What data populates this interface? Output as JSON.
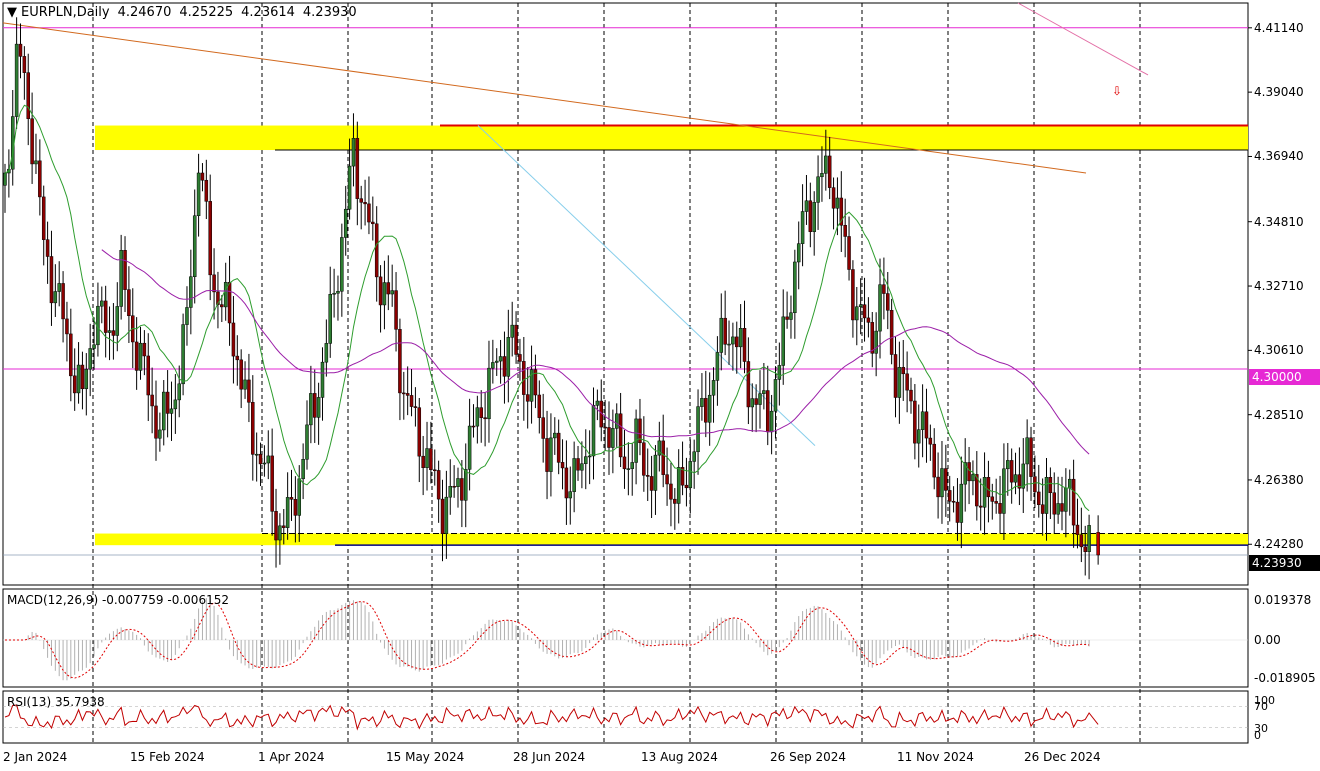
{
  "chart_title": {
    "symbol_timeframe": "EURPLN,Daily",
    "ohlc": [
      "4.24670",
      "4.25225",
      "4.23614",
      "4.23930"
    ]
  },
  "chart_data": [
    {
      "type": "candlestick",
      "name": "EURPLN,Daily",
      "open": 4.2467,
      "high": 4.25225,
      "low": 4.23614,
      "close": 4.2393,
      "y_ticks": [
        "4.41140",
        "4.39040",
        "4.36940",
        "4.34810",
        "4.32710",
        "4.30610",
        "4.28510",
        "4.26380",
        "4.24280"
      ],
      "ylim": [
        4.2295,
        4.4195
      ],
      "x_ticks": [
        "2 Jan 2024",
        "15 Feb 2024",
        "1 Apr 2024",
        "15 May 2024",
        "28 Jun 2024",
        "13 Aug 2024",
        "26 Sep 2024",
        "11 Nov 2024",
        "26 Dec 2024"
      ],
      "horizontal_levels": [
        {
          "value": 4.3,
          "label": "4.30000",
          "color": "#e629d4"
        },
        {
          "value": 4.4114,
          "color": "#e629d4"
        }
      ],
      "last_price_label": "4.23930",
      "zones": [
        {
          "from": 4.3715,
          "to": 4.3795,
          "color": "#ffff00"
        },
        {
          "from": 4.2425,
          "to": 4.2463,
          "color": "#ffff00"
        }
      ],
      "moving_averages": [
        "green",
        "purple"
      ],
      "trendlines": [
        "orange descending",
        "light blue descending",
        "pink descending"
      ],
      "grid": "vertical dashed",
      "series_points": [
        [
          0,
          4.36
        ],
        [
          10,
          4.405
        ],
        [
          20,
          4.38
        ],
        [
          30,
          4.34
        ],
        [
          40,
          4.325
        ],
        [
          50,
          4.305
        ],
        [
          60,
          4.29
        ],
        [
          70,
          4.32
        ],
        [
          80,
          4.31
        ],
        [
          90,
          4.33
        ],
        [
          100,
          4.31
        ],
        [
          110,
          4.295
        ],
        [
          120,
          4.28
        ],
        [
          130,
          4.29
        ],
        [
          140,
          4.31
        ],
        [
          150,
          4.37
        ],
        [
          160,
          4.33
        ],
        [
          170,
          4.32
        ],
        [
          180,
          4.305
        ],
        [
          190,
          4.28
        ],
        [
          200,
          4.27
        ],
        [
          210,
          4.25
        ],
        [
          220,
          4.25
        ],
        [
          230,
          4.27
        ],
        [
          240,
          4.29
        ],
        [
          250,
          4.31
        ],
        [
          260,
          4.34
        ],
        [
          270,
          4.37
        ],
        [
          280,
          4.35
        ],
        [
          290,
          4.33
        ],
        [
          300,
          4.32
        ],
        [
          310,
          4.29
        ],
        [
          320,
          4.28
        ],
        [
          330,
          4.265
        ],
        [
          340,
          4.255
        ],
        [
          350,
          4.26
        ],
        [
          360,
          4.275
        ],
        [
          370,
          4.29
        ],
        [
          380,
          4.3
        ],
        [
          390,
          4.31
        ],
        [
          400,
          4.3
        ],
        [
          410,
          4.29
        ],
        [
          420,
          4.275
        ],
        [
          430,
          4.27
        ],
        [
          440,
          4.26
        ],
        [
          450,
          4.275
        ],
        [
          460,
          4.285
        ],
        [
          470,
          4.28
        ],
        [
          480,
          4.27
        ],
        [
          490,
          4.275
        ],
        [
          500,
          4.265
        ],
        [
          510,
          4.27
        ],
        [
          520,
          4.255
        ],
        [
          530,
          4.27
        ],
        [
          540,
          4.285
        ],
        [
          550,
          4.3
        ],
        [
          560,
          4.315
        ],
        [
          570,
          4.305
        ],
        [
          580,
          4.29
        ],
        [
          590,
          4.285
        ],
        [
          600,
          4.3
        ],
        [
          610,
          4.33
        ],
        [
          620,
          4.35
        ],
        [
          630,
          4.36
        ],
        [
          640,
          4.365
        ],
        [
          650,
          4.34
        ],
        [
          660,
          4.32
        ],
        [
          670,
          4.31
        ],
        [
          680,
          4.325
        ],
        [
          690,
          4.3
        ],
        [
          700,
          4.29
        ],
        [
          710,
          4.28
        ],
        [
          720,
          4.27
        ],
        [
          730,
          4.255
        ],
        [
          740,
          4.26
        ],
        [
          750,
          4.265
        ],
        [
          760,
          4.255
        ],
        [
          770,
          4.26
        ],
        [
          780,
          4.265
        ],
        [
          790,
          4.27
        ],
        [
          800,
          4.26
        ],
        [
          810,
          4.255
        ],
        [
          820,
          4.26
        ],
        [
          830,
          4.25
        ],
        [
          840,
          4.2393
        ]
      ]
    },
    {
      "type": "bar",
      "name": "MACD(12,26,9)",
      "values_label": [
        "-0.007759",
        "-0.006152"
      ],
      "y_ticks": [
        "0.019378",
        "0.00",
        "-0.018905"
      ]
    },
    {
      "type": "line",
      "name": "RSI(13)",
      "value_label": "35.7938",
      "y_ticks": [
        "100",
        "70",
        "30",
        "0"
      ]
    }
  ]
}
